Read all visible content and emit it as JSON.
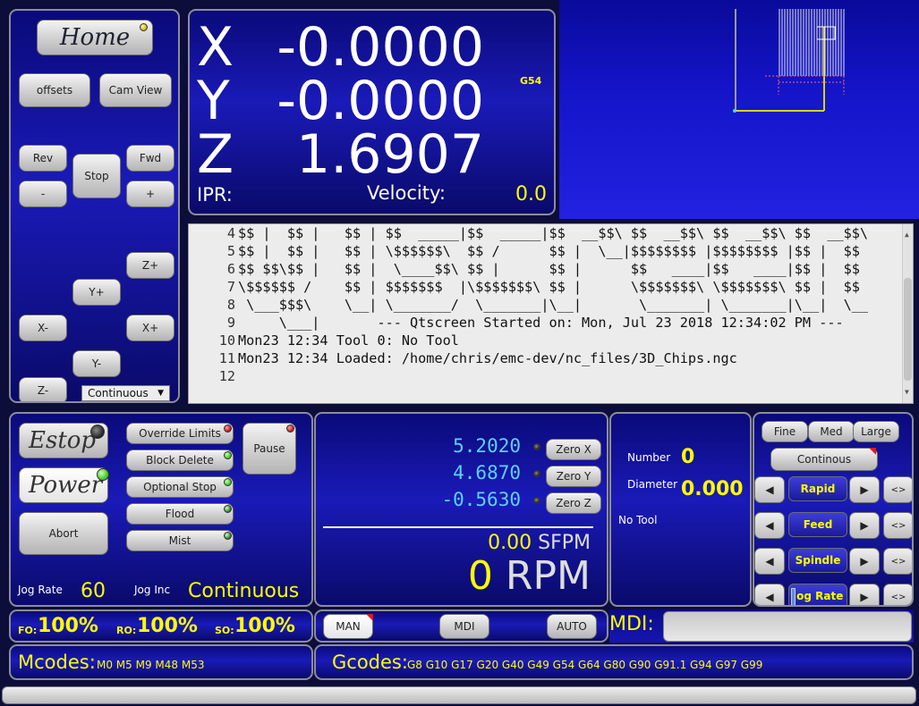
{
  "left_panel": {
    "home": "Home",
    "offsets": "offsets",
    "cam_view": "Cam View",
    "rev": "Rev",
    "fwd": "Fwd",
    "stop": "Stop",
    "minus": "-",
    "plus": "+",
    "z_plus": "Z+",
    "y_plus": "Y+",
    "x_minus": "X-",
    "x_plus": "X+",
    "y_minus": "Y-",
    "z_minus": "Z-",
    "jog_mode": "Continuous"
  },
  "dro": {
    "x_label": "X",
    "x_value": "-0.0000",
    "y_label": "Y",
    "y_value": "-0.0000",
    "z_label": "Z",
    "z_value": "1.6907",
    "coord_system": "G54",
    "ipr_label": "IPR:",
    "velocity_label": "Velocity:",
    "velocity_value": "0.0"
  },
  "console": {
    "lines": [
      {
        "n": "4",
        "t": "$$ |  $$ |   $$ | $$  _____|$$  _____|$$  __$$\\ $$  __$$\\ $$  __$$\\ $$  __$$\\"
      },
      {
        "n": "5",
        "t": "$$ |  $$ |   $$ | \\$$$$$$\\  $$ /      $$ |  \\__|$$$$$$$$ |$$$$$$$$ |$$ |  $$"
      },
      {
        "n": "6",
        "t": "$$ $$\\$$ |   $$ |  \\____$$\\ $$ |      $$ |      $$   ____|$$   ____|$$ |  $$"
      },
      {
        "n": "7",
        "t": "\\$$$$$$ /    $$ | $$$$$$$  |\\$$$$$$$\\ $$ |      \\$$$$$$$\\ \\$$$$$$$\\ $$ |  $$"
      },
      {
        "n": "8",
        "t": " \\___$$$\\    \\__| \\_______/  \\_______|\\__|       \\_______| \\_______|\\__|  \\__"
      },
      {
        "n": "9",
        "t": "     \\___|       --- Qtscreen Started on: Mon, Jul 23 2018 12:34:02 PM ---"
      },
      {
        "n": "10",
        "t": "Mon23 12:34 Tool 0: No Tool"
      },
      {
        "n": "11",
        "t": "Mon23 12:34 Loaded: /home/chris/emc-dev/nc_files/3D_Chips.ngc"
      },
      {
        "n": "12",
        "t": ""
      }
    ]
  },
  "machine": {
    "estop": "Estop",
    "power": "Power",
    "abort": "Abort",
    "override_limits": "Override Limits",
    "block_delete": "Block Delete",
    "optional_stop": "Optional Stop",
    "flood": "Flood",
    "mist": "Mist",
    "pause": "Pause",
    "jog_rate_label": "Jog Rate",
    "jog_rate_value": "60",
    "jog_inc_label": "Jog Inc",
    "jog_inc_value": "Continuous"
  },
  "work": {
    "x_rel": "5.2020",
    "y_rel": "4.6870",
    "z_rel": "-0.5630",
    "zero_x": "Zero X",
    "zero_y": "Zero Y",
    "zero_z": "Zero Z",
    "sfpm_value": "0.00",
    "sfpm_unit": "SFPM",
    "rpm_value": "0",
    "rpm_unit": "RPM"
  },
  "tool": {
    "number_label": "Number",
    "number_value": "0",
    "diameter_label": "Diameter",
    "diameter_value": "0.000",
    "tool_name": "No Tool"
  },
  "jogging": {
    "fine": "Fine",
    "med": "Med",
    "large": "Large",
    "continous": "Continous",
    "rapid": "Rapid",
    "feed": "Feed",
    "spindle": "Spindle",
    "jog_rate": "Jog Rate",
    "toggle_glyph": "<>"
  },
  "overrides": {
    "fo_label": "FO:",
    "fo_value": "100%",
    "ro_label": "RO:",
    "ro_value": "100%",
    "so_label": "SO:",
    "so_value": "100%"
  },
  "modes": {
    "man": "MAN",
    "mdi": "MDI",
    "auto": "AUTO"
  },
  "mdi": {
    "label": "MDI:",
    "value": ""
  },
  "codes": {
    "mcodes_label": "Mcodes:",
    "mcodes_value": "M0 M5 M9 M48 M53",
    "gcodes_label": "Gcodes:",
    "gcodes_value": "G8 G10 G17 G20 G40 G49 G54 G64 G80 G90 G91.1 G94 G97 G99"
  },
  "colors": {
    "panel_blue": "#1a1ab8",
    "accent_yellow": "#ffff00",
    "dro_cyan": "#5fd0ff",
    "led_green": "#38c418",
    "led_red": "#c01515"
  }
}
